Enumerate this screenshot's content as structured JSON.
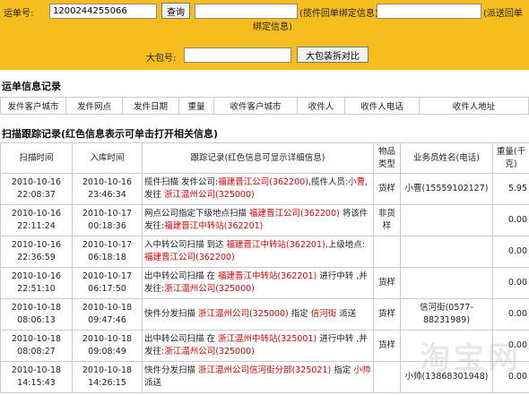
{
  "search": {
    "waybill_label": "运单号:",
    "waybill_value": "1200244255066",
    "query_button": "查询",
    "pickup_bind_label": "(揽件回单绑定信息)",
    "deliver_bind_label_1": "(派送回单",
    "deliver_bind_label_2": "绑定信息)",
    "bag_label": "大包号:",
    "bag_value": "",
    "bag_button": "大包装拆对比"
  },
  "waybill_info": {
    "title": "运单信息记录",
    "columns": [
      "发件客户城市",
      "发件网点",
      "发件日期",
      "重量",
      "收件客户城市",
      "收件人",
      "收件人电话",
      "收件人地址"
    ]
  },
  "scan_track": {
    "title": "扫描跟踪记录(红色信息表示可单击打开相关信息)",
    "columns": {
      "scan_time": "扫描时间",
      "in_time": "入库时间",
      "record": "跟踪记录(红色信息可显示详细信息)",
      "type": "物品类型",
      "courier": "业务员姓名(电话)",
      "weight": "重量(千克)"
    },
    "rows": [
      {
        "scan_date": "2010-10-16",
        "scan_time": "22:08:37",
        "in_date": "2010-10-16",
        "in_time": "23:46:34",
        "parts": [
          {
            "t": "揽件扫描 发件公司:"
          },
          {
            "t": "福建晋江公司(362200)",
            "red": true
          },
          {
            "t": ",揽件人员:"
          },
          {
            "t": "小曹",
            "red": true
          },
          {
            "t": ",发往 "
          },
          {
            "t": "浙江温州公司(325000)",
            "red": true
          }
        ],
        "type": "货样",
        "courier": "小曹(15559102127)",
        "weight": "5.95"
      },
      {
        "scan_date": "2010-10-16",
        "scan_time": "22:11:24",
        "in_date": "2010-10-17",
        "in_time": "00:18:36",
        "parts": [
          {
            "t": "网点公司指定下级地点扫描 "
          },
          {
            "t": "福建晋江公司(362200)",
            "red": true
          },
          {
            "t": " 将该件发往:"
          },
          {
            "t": "福建晋江中转站(362201)",
            "red": true
          }
        ],
        "type": "非货样",
        "courier": "",
        "weight": "0.00"
      },
      {
        "scan_date": "2010-10-16",
        "scan_time": "22:36:59",
        "in_date": "2010-10-17",
        "in_time": "06:18:18",
        "parts": [
          {
            "t": "入中转公司扫描 到达 "
          },
          {
            "t": "福建晋江中转站(362201)",
            "red": true
          },
          {
            "t": ",上级地点:"
          },
          {
            "t": "福建晋江公司(362200)",
            "red": true
          }
        ],
        "type": "",
        "courier": "",
        "weight": "0.00"
      },
      {
        "scan_date": "2010-10-16",
        "scan_time": "22:51:10",
        "in_date": "2010-10-17",
        "in_time": "06:17:50",
        "parts": [
          {
            "t": "出中转公司扫描 在 "
          },
          {
            "t": "福建晋江中转站(362201)",
            "red": true
          },
          {
            "t": " 进行中转 ,并发往:"
          },
          {
            "t": "浙江温州公司(325000)",
            "red": true
          }
        ],
        "type": "货样",
        "courier": "",
        "weight": "0.00"
      },
      {
        "scan_date": "2010-10-18",
        "scan_time": "08:06:13",
        "in_date": "2010-10-18",
        "in_time": "09:47:46",
        "parts": [
          {
            "t": "快件分发扫描 "
          },
          {
            "t": "浙江温州公司(325000)",
            "red": true
          },
          {
            "t": " 指定 "
          },
          {
            "t": "信河街",
            "red": true
          },
          {
            "t": " 派送"
          }
        ],
        "type": "货样",
        "courier": "信河街(0577-88231989)",
        "weight": "0.00"
      },
      {
        "scan_date": "2010-10-18",
        "scan_time": "08:08:27",
        "in_date": "2010-10-18",
        "in_time": "09:08:49",
        "parts": [
          {
            "t": "出中转公司扫描 在 "
          },
          {
            "t": "浙江温州中转站(325001)",
            "red": true
          },
          {
            "t": " 进行中转 ,并发往:"
          },
          {
            "t": "浙江温州公司(325000)",
            "red": true
          }
        ],
        "type": "货样",
        "courier": "",
        "weight": "0.00"
      },
      {
        "scan_date": "2010-10-18",
        "scan_time": "14:15:43",
        "in_date": "2010-10-18",
        "in_time": "14:26:15",
        "parts": [
          {
            "t": "快件分发扫描 "
          },
          {
            "t": "浙江温州公司信河街分部(325021)",
            "red": true
          },
          {
            "t": " 指定 "
          },
          {
            "t": "小帅",
            "red": true
          },
          {
            "t": " 派送"
          }
        ],
        "type": "",
        "courier": "小帅(13868301948)",
        "weight": "0.00"
      }
    ]
  },
  "watermark": "淘宝网"
}
